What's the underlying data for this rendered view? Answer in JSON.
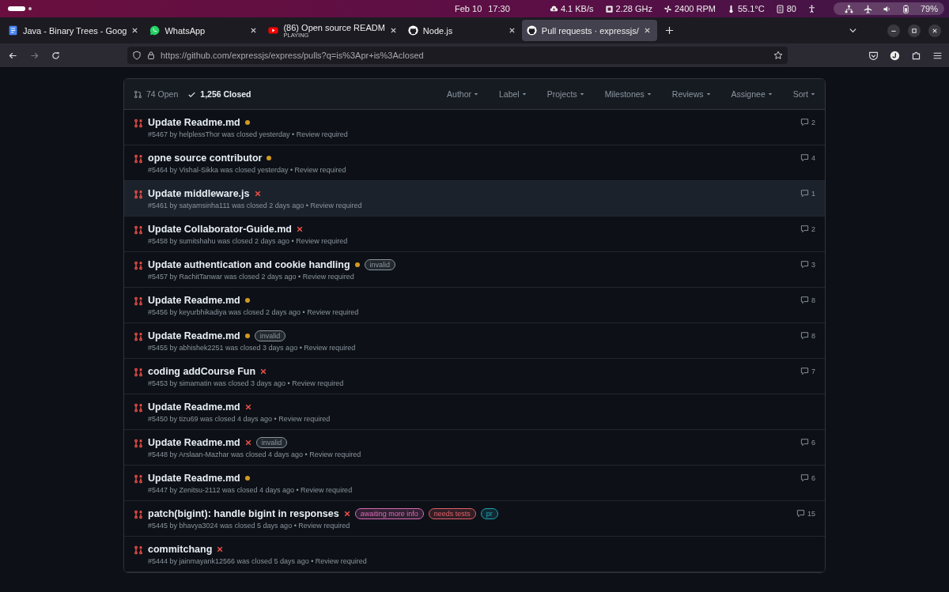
{
  "system_bar": {
    "date": "Feb 10",
    "time": "17:30",
    "net_speed": "4.1 KB/s",
    "cpu_freq": "2.28 GHz",
    "fan": "2400 RPM",
    "temperature": "55.1°C",
    "memory": "80",
    "battery": "79%"
  },
  "browser": {
    "tabs": [
      {
        "title": "Java - Binary Trees - Goog",
        "selected": false
      },
      {
        "title": "WhatsApp",
        "selected": false
      },
      {
        "title": "(86) Open source READM",
        "subtitle": "PLAYING",
        "selected": false
      },
      {
        "title": "Node.js",
        "selected": false
      },
      {
        "title": "Pull requests · expressjs/",
        "selected": true
      }
    ],
    "url": "https://github.com/expressjs/express/pulls?q=is%3Apr+is%3Aclosed"
  },
  "pull_list": {
    "states": [
      {
        "label": "74 Open",
        "selected": false
      },
      {
        "label": "1,256 Closed",
        "selected": true
      }
    ],
    "filters": [
      "Author",
      "Label",
      "Projects",
      "Milestones",
      "Reviews",
      "Assignee",
      "Sort"
    ],
    "rows": [
      {
        "title": "Update Readme.md",
        "checks_failed": false,
        "meta": "#5467 by helplessThor was closed yesterday • Review required",
        "comments": "2",
        "highlighted": false
      },
      {
        "title": "opne source contributor",
        "checks_failed": false,
        "meta": "#5464 by Vishal-Sikka was closed yesterday • Review required",
        "comments": "4",
        "highlighted": false
      },
      {
        "title": "Update middleware.js",
        "checks_failed": true,
        "meta": "#5461 by satyamsinha111 was closed 2 days ago • Review required",
        "comments": "1",
        "highlighted": true
      },
      {
        "title": "Update Collaborator-Guide.md",
        "checks_failed": true,
        "meta": "#5458 by sumitshahu was closed 2 days ago • Review required",
        "comments": "2",
        "highlighted": false
      },
      {
        "title": "Update authentication and cookie handling",
        "checks_failed": false,
        "labels": [
          {
            "name": "invalid",
            "color": "#8b949e"
          }
        ],
        "meta": "#5457 by RachitTanwar was closed 2 days ago • Review required",
        "comments": "3",
        "highlighted": false
      },
      {
        "title": "Update Readme.md",
        "checks_failed": false,
        "meta": "#5456 by keyurbhikadiya was closed 2 days ago • Review required",
        "comments": "8",
        "highlighted": false
      },
      {
        "title": "Update Readme.md",
        "checks_failed": false,
        "labels": [
          {
            "name": "invalid",
            "color": "#8b949e"
          }
        ],
        "meta": "#5455 by abhishek2251 was closed 3 days ago • Review required",
        "comments": "8",
        "highlighted": false
      },
      {
        "title": "coding addCourse Fun",
        "checks_failed": true,
        "meta": "#5453 by simamatin was closed 3 days ago • Review required",
        "comments": "7",
        "highlighted": false
      },
      {
        "title": "Update Readme.md",
        "checks_failed": true,
        "meta": "#5450 by tizu69 was closed 4 days ago • Review required",
        "highlighted": false
      },
      {
        "title": "Update Readme.md",
        "checks_failed": true,
        "labels": [
          {
            "name": "invalid",
            "color": "#8b949e"
          }
        ],
        "meta": "#5448 by Arslaan-Mazhar was closed 4 days ago • Review required",
        "comments": "6",
        "highlighted": false
      },
      {
        "title": "Update Readme.md",
        "checks_failed": false,
        "meta": "#5447 by Zenitsu-2112 was closed 4 days ago • Review required",
        "comments": "6",
        "highlighted": false
      },
      {
        "title": "patch(bigint): handle bigint in responses",
        "checks_failed": true,
        "labels": [
          {
            "name": "awaiting more info",
            "color": "#d96bb5"
          },
          {
            "name": "needs tests",
            "color": "#e0606a"
          },
          {
            "name": "pr",
            "color": "#1fa3b5"
          }
        ],
        "meta": "#5445 by bhavya3024 was closed 5 days ago • Review required",
        "comments": "15",
        "highlighted": false
      },
      {
        "title": "commitchang",
        "checks_failed": true,
        "meta": "#5444 by jainmayank12566 was closed 5 days ago • Review required",
        "highlighted": false
      }
    ]
  }
}
